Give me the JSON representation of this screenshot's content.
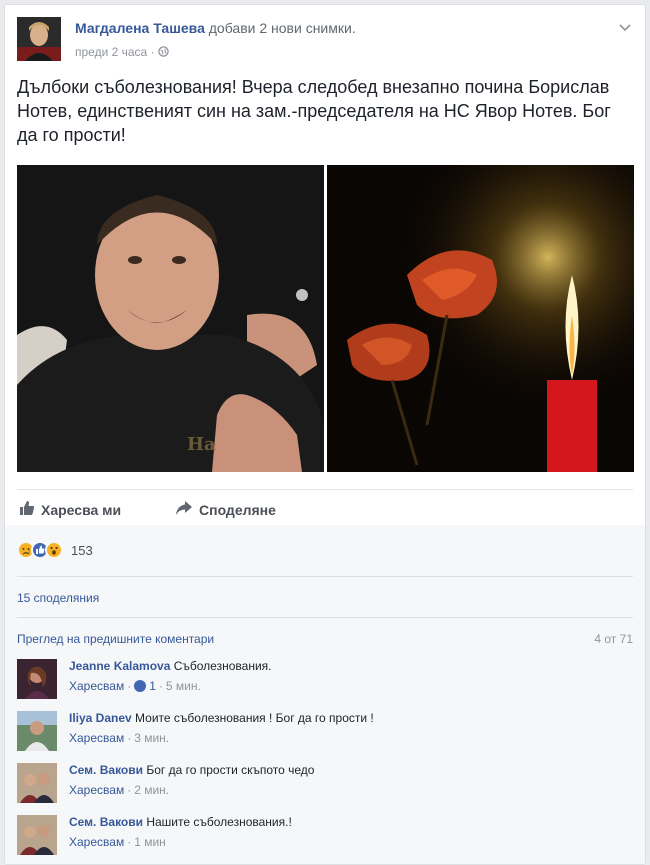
{
  "post": {
    "author": "Магдалена Ташева",
    "action": "добави 2 нови снимки.",
    "time": "преди 2 часа",
    "privacy_icon": "globe-icon",
    "text": "Дълбоки съболезнования! Вчера следобед внезапно почина Борислав Нотев, единственият син на зам.-председателя на НС Явор Нотев. Бог да го прости!"
  },
  "actions": {
    "like_label": "Харесва ми",
    "share_label": "Споделяне"
  },
  "reactions": {
    "count": "153",
    "icons": [
      "sad-reaction-icon",
      "like-reaction-icon",
      "wow-reaction-icon"
    ],
    "colors": {
      "sad": "#f7b125",
      "like": "#4267b2",
      "wow": "#f7b125"
    }
  },
  "shares": "15 споделяния",
  "comments_header": {
    "prev_label": "Преглед на предишните коментари",
    "count_label": "4 от 71"
  },
  "comments": [
    {
      "name": "Jeanne Kalamova",
      "text": "Съболезнования.",
      "like": "Харесвам",
      "dot": "·",
      "likes": "1",
      "dot2": "·",
      "time": "5 мин."
    },
    {
      "name": "Iliya Danev",
      "text": "Моите съболезнования ! Бог да го прости !",
      "like": "Харесвам",
      "dot": "·",
      "time": "3 мин."
    },
    {
      "name": "Сем. Вакови",
      "text": "Бог да го прости скъпото чедо",
      "like": "Харесвам",
      "dot": "·",
      "time": "2 мин."
    },
    {
      "name": "Сем. Вакови",
      "text": "Нашите съболезнования.!",
      "like": "Харесвам",
      "dot": "·",
      "time": "1 мин"
    }
  ],
  "colors": {
    "link": "#365899",
    "secondary": "#90949c",
    "background": "#e9ebee"
  }
}
